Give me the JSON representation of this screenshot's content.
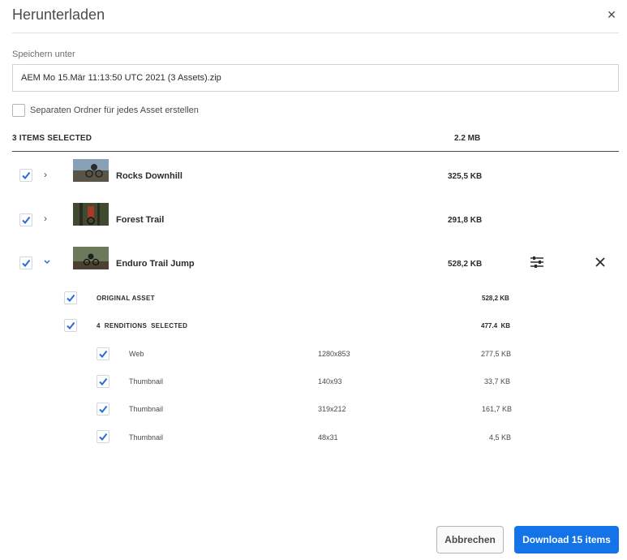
{
  "dialog": {
    "title": "Herunterladen",
    "save_label": "Speichern unter",
    "filename": "AEM Mo 15.Mär 11:13:50 UTC 2021 (3 Assets).zip",
    "separate_folder_label": "Separaten Ordner für jedes Asset erstellen",
    "selected_header": "3 ITEMS SELECTED",
    "total_size": "2.2  MB"
  },
  "assets": [
    {
      "name": "Rocks Downhill",
      "size": "325,5 KB",
      "checked": true,
      "expanded": false
    },
    {
      "name": "Forest Trail",
      "size": "291,8 KB",
      "checked": true,
      "expanded": false
    },
    {
      "name": "Enduro Trail Jump",
      "size": "528,2 KB",
      "checked": true,
      "expanded": true
    }
  ],
  "expanded_asset": {
    "original_label": "ORIGINAL ASSET",
    "original_size": "528,2 KB",
    "renditions_label": "4  RENDITIONS  SELECTED",
    "renditions_size": "477.4  KB",
    "renditions": [
      {
        "name": "Web",
        "dims": "1280x853",
        "size": "277,5 KB"
      },
      {
        "name": "Thumbnail",
        "dims": "140x93",
        "size": "33,7 KB"
      },
      {
        "name": "Thumbnail",
        "dims": "319x212",
        "size": "161,7 KB"
      },
      {
        "name": "Thumbnail",
        "dims": "48x31",
        "size": "4,5 KB"
      }
    ]
  },
  "buttons": {
    "cancel": "Abbrechen",
    "download": "Download 15 items"
  },
  "icons": {
    "close": "close-icon",
    "chevron_right": "chevron-right-icon",
    "chevron_down": "chevron-down-icon",
    "settings": "sliders-icon",
    "remove": "remove-icon",
    "check": "checkmark-icon"
  },
  "colors": {
    "accent": "#1473e6",
    "check": "#2c6bd6",
    "text": "#2c2c2c"
  }
}
